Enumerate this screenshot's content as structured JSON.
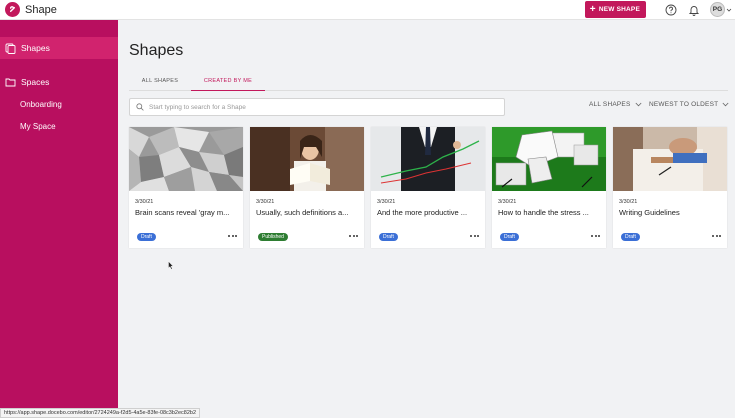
{
  "app": {
    "name": "Shape"
  },
  "header": {
    "new_shape_label": "NEW SHAPE",
    "avatar_initials": "PG"
  },
  "sidebar": {
    "items": [
      {
        "label": "Shapes",
        "icon": "shapes-icon",
        "active": true
      },
      {
        "label": "Spaces",
        "icon": "folder-icon"
      }
    ],
    "sub_items": [
      {
        "label": "Onboarding"
      },
      {
        "label": "My Space"
      }
    ]
  },
  "main": {
    "title": "Shapes",
    "tabs": [
      {
        "label": "ALL SHAPES"
      },
      {
        "label": "CREATED BY ME",
        "active": true
      }
    ],
    "search": {
      "placeholder": "Start typing to search for a Shape",
      "value": ""
    },
    "filters": {
      "type_label": "ALL SHAPES",
      "sort_label": "NEWEST TO OLDEST"
    }
  },
  "cards": [
    {
      "date": "3/30/21",
      "title": "Brain scans reveal 'gray m...",
      "status": "Draft"
    },
    {
      "date": "3/30/21",
      "title": "Usually, such definitions a...",
      "status": "Published"
    },
    {
      "date": "3/30/21",
      "title": "And the more productive ...",
      "status": "Draft"
    },
    {
      "date": "3/30/21",
      "title": "How to handle the stress ...",
      "status": "Draft"
    },
    {
      "date": "3/30/21",
      "title": "Writing Guidelines",
      "status": "Draft"
    }
  ],
  "status_bar": {
    "url": "https://app.shape.docebo.com/editor/2724249a-f2d5-4a5e-83fe-08c3b2ec82b2"
  },
  "colors": {
    "brand": "#b80f5f",
    "accent": "#c2185b",
    "draft": "#3b6fd6",
    "published": "#2e7d32"
  }
}
